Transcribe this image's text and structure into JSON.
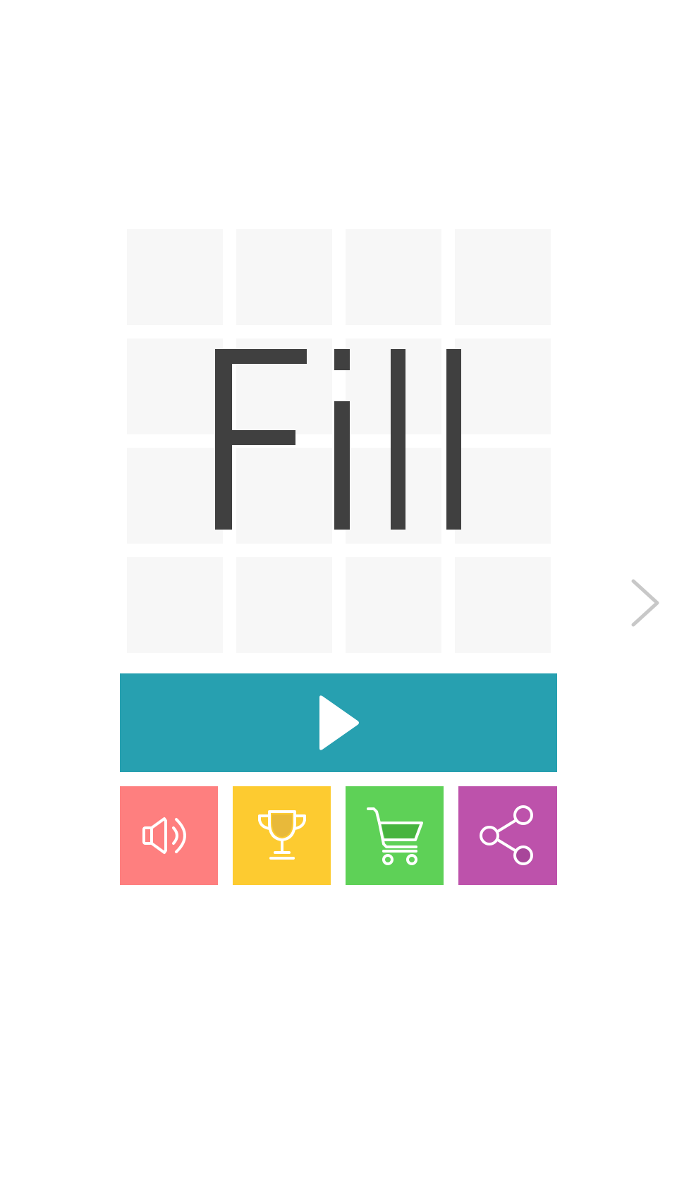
{
  "title": {
    "text": "Fill",
    "color": "#404040"
  },
  "board": {
    "tile_color": "#f7f7f7",
    "rows": 4,
    "cols": 4
  },
  "navigation": {
    "next_icon": "chevron-right-icon",
    "color": "#c8c8c8"
  },
  "play_button": {
    "icon": "play-icon",
    "color": "#27a0b0"
  },
  "menu_buttons": [
    {
      "name": "sound",
      "icon": "speaker-icon",
      "color": "#fe7f7f"
    },
    {
      "name": "leaderboard",
      "icon": "trophy-icon",
      "color": "#fdcb30"
    },
    {
      "name": "shop",
      "icon": "shopping-cart-icon",
      "color": "#5ed157"
    },
    {
      "name": "share",
      "icon": "share-icon",
      "color": "#bd52ab"
    }
  ]
}
